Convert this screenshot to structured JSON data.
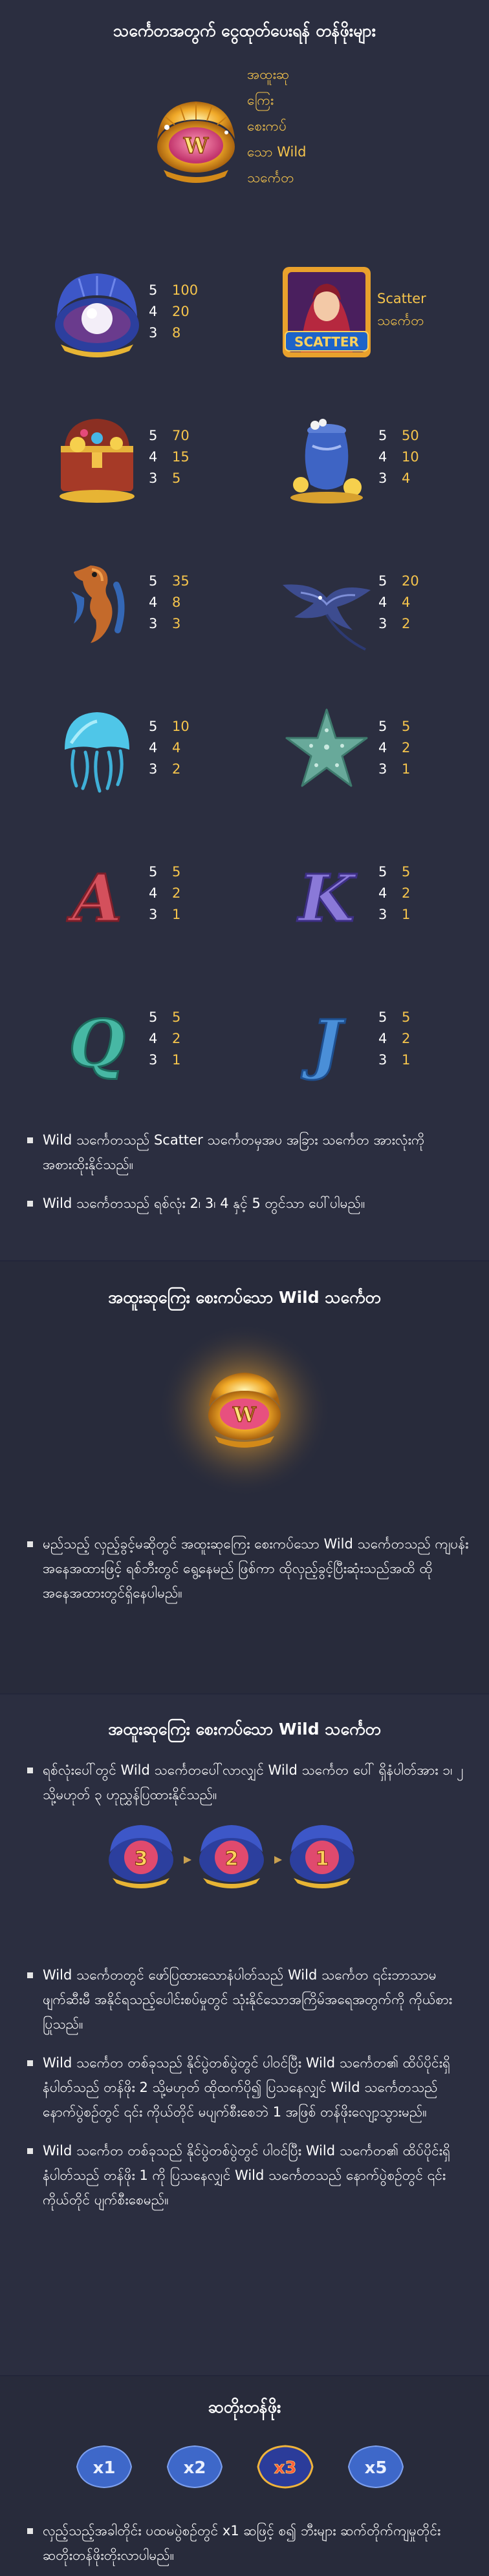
{
  "section1": {
    "title": "သင်္ကေတအတွက် ငွေထုတ်ပေးရန် တန်ဖိုးများ",
    "wild_label": "အထူးဆု ကြေး စေးကပ်သော Wild သင်္ကေတ",
    "wild_label_lines": [
      "အထူးဆု",
      "ကြေး",
      "စေးကပ်",
      "သော Wild",
      "သင်္ကေတ"
    ],
    "scatter_label_lines": [
      "Scatter",
      "သင်္ကေတ"
    ],
    "scatter_badge": "SCATTER",
    "symbols": [
      {
        "icon": "pearl-oyster-icon",
        "pays": [
          {
            "n": "5",
            "v": "100"
          },
          {
            "n": "4",
            "v": "20"
          },
          {
            "n": "3",
            "v": "8"
          }
        ]
      },
      {
        "icon": "treasure-chest-icon",
        "pays": [
          {
            "n": "5",
            "v": "70"
          },
          {
            "n": "4",
            "v": "15"
          },
          {
            "n": "3",
            "v": "5"
          }
        ]
      },
      {
        "icon": "treasure-pot-icon",
        "pays": [
          {
            "n": "5",
            "v": "50"
          },
          {
            "n": "4",
            "v": "10"
          },
          {
            "n": "3",
            "v": "4"
          }
        ]
      },
      {
        "icon": "seahorse-icon",
        "pays": [
          {
            "n": "5",
            "v": "35"
          },
          {
            "n": "4",
            "v": "8"
          },
          {
            "n": "3",
            "v": "3"
          }
        ]
      },
      {
        "icon": "manta-ray-icon",
        "pays": [
          {
            "n": "5",
            "v": "20"
          },
          {
            "n": "4",
            "v": "4"
          },
          {
            "n": "3",
            "v": "2"
          }
        ]
      },
      {
        "icon": "jellyfish-icon",
        "pays": [
          {
            "n": "5",
            "v": "10"
          },
          {
            "n": "4",
            "v": "4"
          },
          {
            "n": "3",
            "v": "2"
          }
        ]
      },
      {
        "icon": "starfish-icon",
        "pays": [
          {
            "n": "5",
            "v": "5"
          },
          {
            "n": "4",
            "v": "2"
          },
          {
            "n": "3",
            "v": "1"
          }
        ]
      },
      {
        "icon": "letter-a-icon",
        "letter": "A",
        "pays": [
          {
            "n": "5",
            "v": "5"
          },
          {
            "n": "4",
            "v": "2"
          },
          {
            "n": "3",
            "v": "1"
          }
        ]
      },
      {
        "icon": "letter-k-icon",
        "letter": "K",
        "pays": [
          {
            "n": "5",
            "v": "5"
          },
          {
            "n": "4",
            "v": "2"
          },
          {
            "n": "3",
            "v": "1"
          }
        ]
      },
      {
        "icon": "letter-q-icon",
        "letter": "Q",
        "pays": [
          {
            "n": "5",
            "v": "5"
          },
          {
            "n": "4",
            "v": "2"
          },
          {
            "n": "3",
            "v": "1"
          }
        ]
      },
      {
        "icon": "letter-j-icon",
        "letter": "J",
        "pays": [
          {
            "n": "5",
            "v": "5"
          },
          {
            "n": "4",
            "v": "2"
          },
          {
            "n": "3",
            "v": "1"
          }
        ]
      }
    ],
    "notes": [
      "Wild သင်္ကေတသည် Scatter သင်္ကေတမှအပ အခြား သင်္ကေတ အားလုံးကို အစားထိုးနိုင်သည်။",
      "Wild သင်္ကေတသည် ရစ်လုံး 2၊ 3၊ 4 နှင့် 5 တွင်သာ ပေါ်ပါမည်။"
    ]
  },
  "section2": {
    "title": "အထူးဆုကြေး စေးကပ်သော Wild သင်္ကေတ",
    "bullet": "မည်သည့် လှည့်ခွင့်မဆိုတွင် အထူးဆုကြေး စေးကပ်သော Wild သင်္ကေတသည် ကျပန်းအနေအထားဖြင့် ရစ်ဘီးတွင် ရွေ့နေမည် ဖြစ်ကာ ထိုလှည့်ခွင့်ပြီးဆုံးသည်အထိ ထိုအနေအထားတွင်ရှိနေပါမည်။"
  },
  "section3": {
    "title": "အထူးဆုကြေး စေးကပ်သော Wild သင်္ကေတ",
    "intro": "ရစ်လုံးပေါ်တွင် Wild သင်္ကေတပေါ်လာလျှင် Wild သင်္ကေတ ပေါ် ရှိနံပါတ်အား ၁၊ ၂ သို့မဟုတ် ၃ ဟုညွှန်ပြထားနိုင်သည်။",
    "chain": [
      "3",
      "2",
      "1"
    ],
    "notes": [
      "Wild သင်္ကေတတွင် ဖော်ပြထားသောနံပါတ်သည် Wild သင်္ကေတ ၎င်းဘာသာမဖျက်ဆီးမီ အနိုင်ရသည့်ပေါင်းစပ်မှုတွင် သုံးနိုင်သောအကြိမ်အရေအတွက်ကို ကိုယ်စားပြုသည်။",
      "Wild သင်္ကေတ တစ်ခုသည် နိုင်ပွဲတစ်ပွဲတွင် ပါဝင်ပြီး Wild သင်္ကေတ၏ ထိပ်ပိုင်းရှိ နံပါတ်သည် တန်ဖိုး 2 သို့မဟုတ် ထိုထက်ပို၍ ပြသနေလျှင် Wild သင်္ကေတသည် နောက်ပွဲစဉ်တွင် ၎င်း ကိုယ်တိုင် မပျက်စီးစေဘဲ 1 အဖြစ် တန်ဖိုးလျော့သွားမည်။",
      "Wild သင်္ကေတ တစ်ခုသည် နိုင်ပွဲတစ်ပွဲတွင် ပါဝင်ပြီး Wild သင်္ကေတ၏ ထိပ်ပိုင်းရှိ နံပါတ်သည် တန်ဖိုး 1 ကို ပြသနေလျှင် Wild သင်္ကေတသည် နောက်ပွဲစဉ်တွင် ၎င်းကိုယ်တိုင် ပျက်စီးစေမည်။"
    ]
  },
  "section4": {
    "title": "ဆတိုးတန်ဖိုး",
    "multipliers": [
      "x1",
      "x2",
      "x3",
      "x5"
    ],
    "bullet": "လှည့်သည့်အခါတိုင်း ပထမပွဲစဉ်တွင် x1 ဆဖြင့် စ၍ ဘီးများ ဆက်တိုက်ကျမှုတိုင်း ဆတိုးတန်ဖိုးတိုးလာပါမည်။"
  },
  "colors": {
    "background": "#2b2e40",
    "gold_text": "#f5c44c",
    "text": "#ffffff",
    "shell_blue": "#3a5fbf",
    "glow": "#f7b733"
  }
}
